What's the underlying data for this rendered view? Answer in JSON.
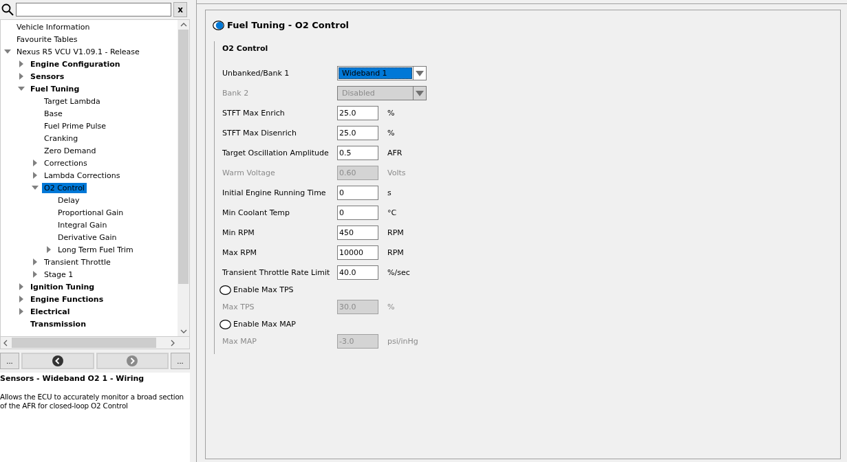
{
  "search": {
    "clear_label": "x"
  },
  "tree": [
    {
      "label": "Vehicle Information",
      "bold": false,
      "selected": false
    },
    {
      "label": "Favourite Tables",
      "bold": false,
      "selected": false
    },
    {
      "label": "Nexus R5 VCU V1.09.1 - Release",
      "bold": false,
      "selected": false,
      "expanded": true,
      "children": [
        {
          "label": "Engine Configuration",
          "bold": true,
          "selected": false,
          "expanded": false
        },
        {
          "label": "Sensors",
          "bold": true,
          "selected": false,
          "expanded": false
        },
        {
          "label": "Fuel Tuning",
          "bold": true,
          "selected": false,
          "expanded": true,
          "children": [
            {
              "label": "Target Lambda",
              "bold": false,
              "selected": false
            },
            {
              "label": "Base",
              "bold": false,
              "selected": false
            },
            {
              "label": "Fuel Prime Pulse",
              "bold": false,
              "selected": false
            },
            {
              "label": "Cranking",
              "bold": false,
              "selected": false
            },
            {
              "label": "Zero Demand",
              "bold": false,
              "selected": false
            },
            {
              "label": "Corrections",
              "bold": false,
              "selected": false,
              "expanded": false
            },
            {
              "label": "Lambda Corrections",
              "bold": false,
              "selected": false,
              "expanded": false
            },
            {
              "label": "O2 Control",
              "bold": false,
              "selected": true,
              "expanded": true,
              "children": [
                {
                  "label": "Delay",
                  "bold": false,
                  "selected": false
                },
                {
                  "label": "Proportional Gain",
                  "bold": false,
                  "selected": false
                },
                {
                  "label": "Integral Gain",
                  "bold": false,
                  "selected": false
                },
                {
                  "label": "Derivative Gain",
                  "bold": false,
                  "selected": false
                },
                {
                  "label": "Long Term Fuel Trim",
                  "bold": false,
                  "selected": false,
                  "expanded": false
                }
              ]
            },
            {
              "label": "Transient Throttle",
              "bold": false,
              "selected": false,
              "expanded": false
            },
            {
              "label": "Stage 1",
              "bold": false,
              "selected": false,
              "expanded": false
            }
          ]
        },
        {
          "label": "Ignition Tuning",
          "bold": true,
          "selected": false,
          "expanded": false
        },
        {
          "label": "Engine Functions",
          "bold": true,
          "selected": false,
          "expanded": false
        },
        {
          "label": "Electrical",
          "bold": true,
          "selected": false,
          "expanded": false
        },
        {
          "label": "Transmission",
          "bold": true,
          "selected": false
        }
      ]
    }
  ],
  "nav": {
    "first_label": "...",
    "last_label": "...",
    "back_disabled": false,
    "forward_disabled": true
  },
  "info": {
    "title": "Sensors - Wideband O2 1 - Wiring",
    "text": "Allows the ECU to accurately monitor a broad section of the AFR for closed-loop O2 Control"
  },
  "page": {
    "title": "Fuel Tuning - O2 Control",
    "on": true,
    "group": "O2 Control",
    "rows": [
      {
        "kind": "select",
        "label": "Unbanked/Bank 1",
        "value": "Wideband 1",
        "disabled": false
      },
      {
        "kind": "select",
        "label": "Bank 2",
        "value": "Disabled",
        "disabled": true
      },
      {
        "kind": "input",
        "label": "STFT Max Enrich",
        "value": "25.0",
        "unit": "%",
        "disabled": false
      },
      {
        "kind": "input",
        "label": "STFT Max Disenrich",
        "value": "25.0",
        "unit": "%",
        "disabled": false
      },
      {
        "kind": "input",
        "label": "Target Oscillation Amplitude",
        "value": "0.5",
        "unit": "AFR",
        "disabled": false
      },
      {
        "kind": "input",
        "label": "Warm Voltage",
        "value": "0.60",
        "unit": "Volts",
        "disabled": true
      },
      {
        "kind": "input",
        "label": "Initial Engine Running Time",
        "value": "0",
        "unit": "s",
        "disabled": false
      },
      {
        "kind": "input",
        "label": "Min Coolant Temp",
        "value": "0",
        "unit": "°C",
        "disabled": false
      },
      {
        "kind": "input",
        "label": "Min RPM",
        "value": "450",
        "unit": "RPM",
        "disabled": false
      },
      {
        "kind": "input",
        "label": "Max RPM",
        "value": "10000",
        "unit": "RPM",
        "disabled": false
      },
      {
        "kind": "input",
        "label": "Transient Throttle Rate Limit",
        "value": "40.0",
        "unit": "%/sec",
        "disabled": false
      },
      {
        "kind": "toggle",
        "label": "Enable Max TPS",
        "on": false
      },
      {
        "kind": "input",
        "label": "Max TPS",
        "value": "30.0",
        "unit": "%",
        "disabled": true
      },
      {
        "kind": "toggle",
        "label": "Enable Max MAP",
        "on": false
      },
      {
        "kind": "input",
        "label": "Max MAP",
        "value": "-3.0",
        "unit": "psi/inHg",
        "disabled": true
      }
    ]
  }
}
